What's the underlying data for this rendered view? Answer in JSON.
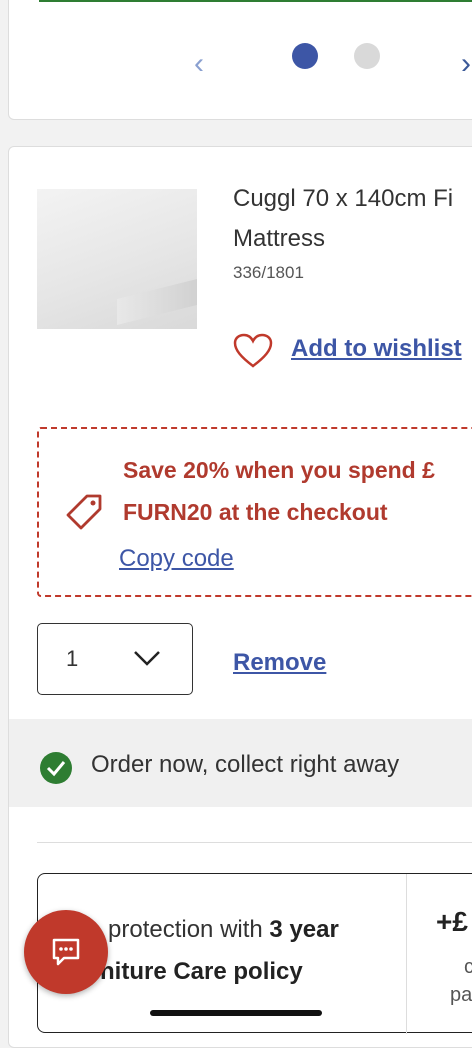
{
  "carousel": {
    "prev_icon": "chevron-left-icon",
    "next_icon": "chevron-right-icon",
    "active_dot_color": "#3d56a6",
    "inactive_dot_color": "#d9d9d9",
    "pages": 2,
    "current_page": 1
  },
  "product": {
    "title_line1": "Cuggl 70 x 140cm Fi",
    "title_line2": "Mattress",
    "sku": "336/1801",
    "wishlist_label": "Add to wishlist",
    "wishlist_icon": "heart-icon"
  },
  "promo": {
    "line1": "Save 20% when you spend £",
    "line2": "FURN20 at the checkout",
    "copy_label": "Copy code",
    "icon": "tag-icon",
    "color": "#b03a2e"
  },
  "quantity": {
    "value": "1",
    "remove_label": "Remove"
  },
  "order": {
    "text": "Order now, collect right away",
    "icon": "check-circle-icon",
    "icon_color": "#2e7d32"
  },
  "care": {
    "line1_pre": "protection with ",
    "line1_bold": "3 year",
    "line2": "niture Care policy",
    "price": "+£",
    "small1": "c",
    "small2": "pa"
  },
  "chat": {
    "icon": "chat-icon",
    "color": "#c0392b"
  },
  "colors": {
    "link": "#3d56a6",
    "accent_red": "#c0392b"
  }
}
